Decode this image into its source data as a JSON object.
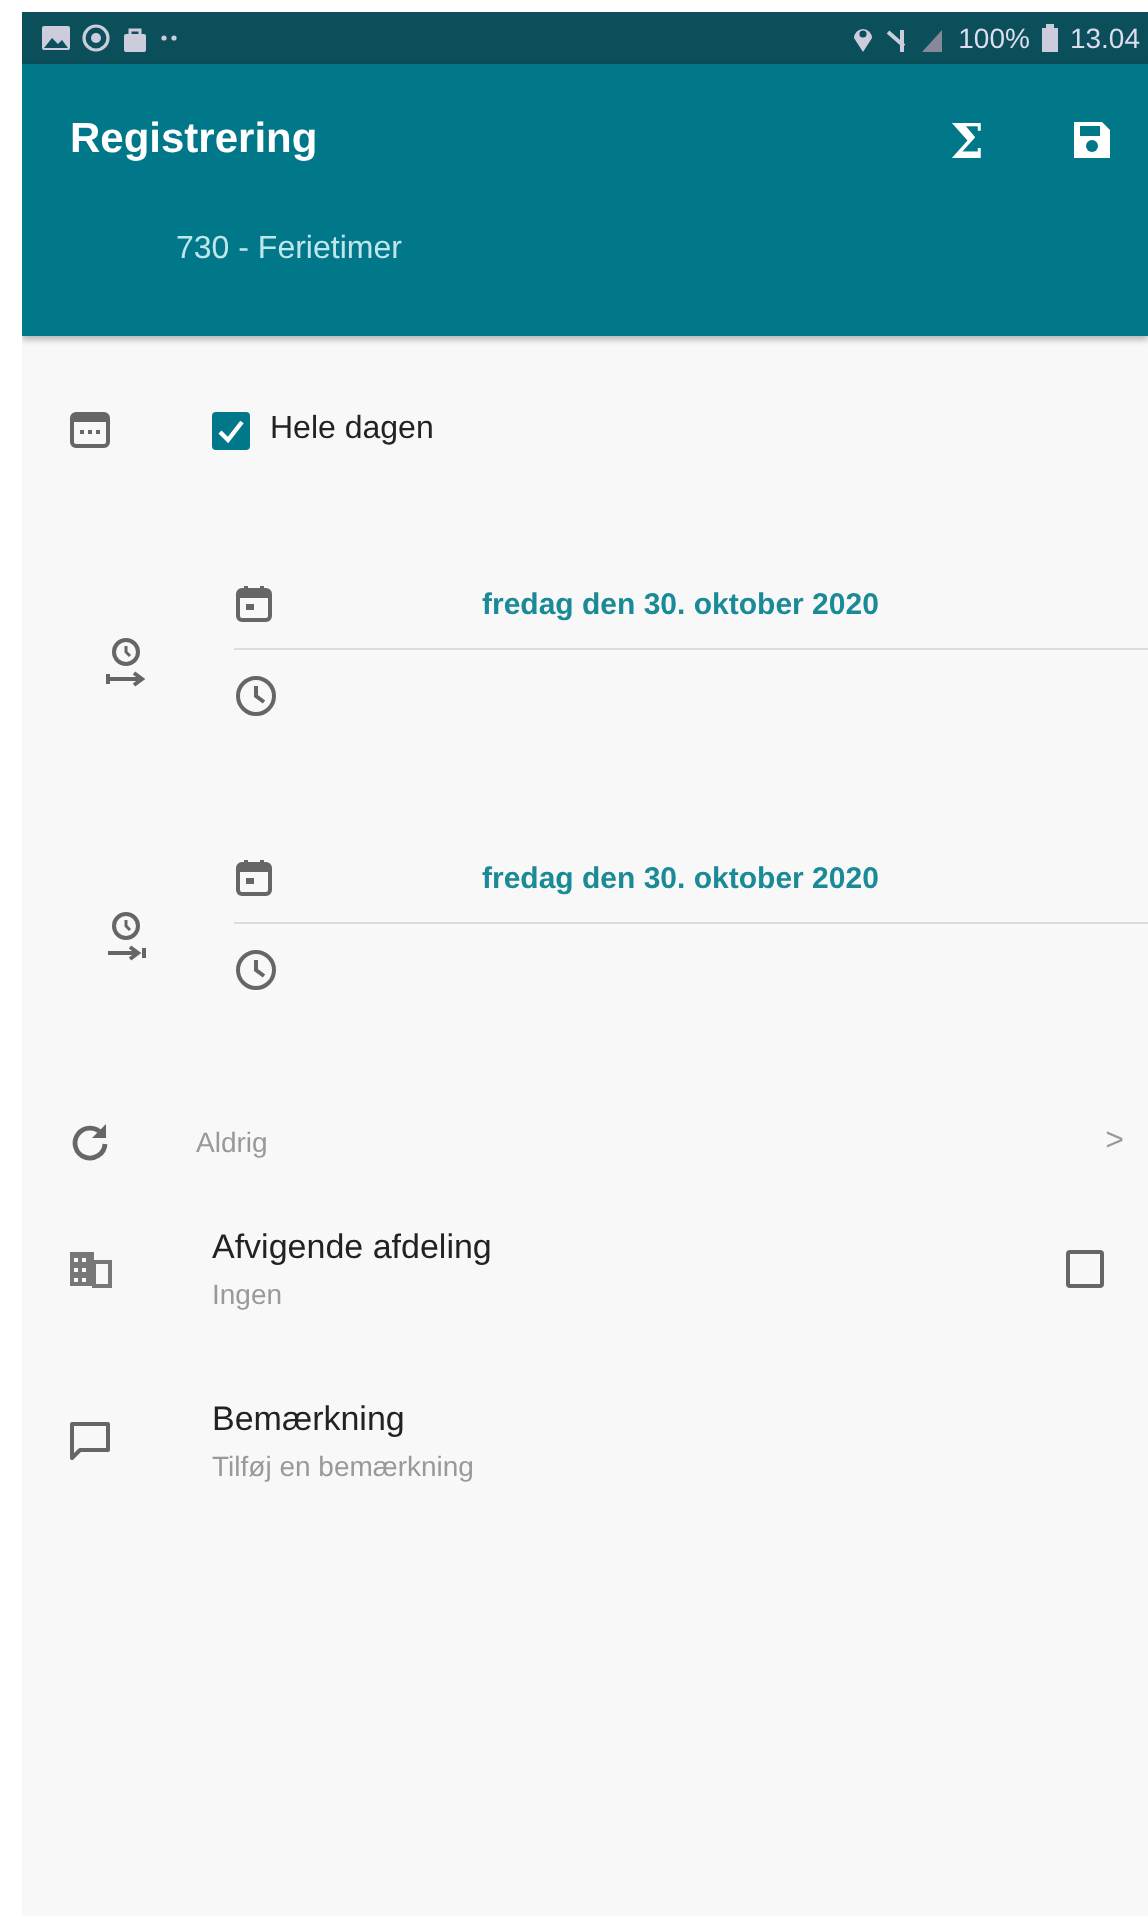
{
  "status_bar": {
    "battery": "100%",
    "time": "13.04"
  },
  "app_bar": {
    "title": "Registrering",
    "subtitle": "730 - Ferietimer",
    "actions": [
      {
        "kind": "sum",
        "label": "Σ"
      },
      {
        "kind": "save"
      }
    ]
  },
  "all_day": {
    "label": "Hele dagen",
    "checked": true
  },
  "periods": [
    {
      "kind": "start",
      "date": "fredag den 30. oktober 2020"
    },
    {
      "kind": "end",
      "date": "fredag den 30. oktober 2020"
    }
  ],
  "repeat": {
    "value": "Aldrig",
    "chevron": ">"
  },
  "department": {
    "title": "Afvigende afdeling",
    "value": "Ingen",
    "checked": false
  },
  "remark": {
    "title": "Bemærkning",
    "hint": "Tilføj en bemærkning"
  }
}
